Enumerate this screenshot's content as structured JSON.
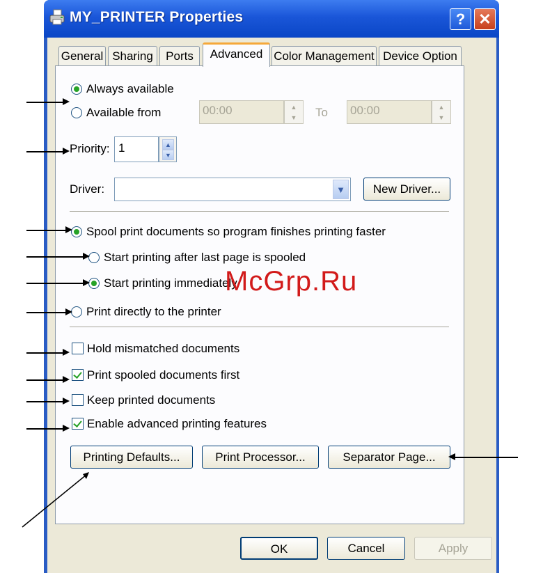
{
  "window": {
    "title": "MY_PRINTER Properties",
    "help_label": "?",
    "close_label": "✕"
  },
  "tabs": [
    "General",
    "Sharing",
    "Ports",
    "Advanced",
    "Color Management",
    "Device Option"
  ],
  "availability": {
    "always_label": "Always available",
    "from_label": "Available from",
    "from_time": "00:00",
    "to_label": "To",
    "to_time": "00:00",
    "selected": "always"
  },
  "priority": {
    "label": "Priority:",
    "value": "1"
  },
  "driver": {
    "label": "Driver:",
    "value": "",
    "new_driver_label": "New Driver..."
  },
  "spooling": {
    "spool_label": "Spool print documents so program finishes printing faster",
    "after_last_label": "Start printing after last page is spooled",
    "immediately_label": "Start printing immediately",
    "direct_label": "Print directly to the printer"
  },
  "options": {
    "hold_label": "Hold mismatched documents",
    "hold_checked": false,
    "spooled_first_label": "Print spooled documents first",
    "spooled_first_checked": true,
    "keep_label": "Keep printed documents",
    "keep_checked": false,
    "advanced_label": "Enable advanced printing features",
    "advanced_checked": true
  },
  "buttons": {
    "printing_defaults": "Printing Defaults...",
    "print_processor": "Print Processor...",
    "separator_page": "Separator Page...",
    "ok": "OK",
    "cancel": "Cancel",
    "apply": "Apply"
  },
  "watermark": "McGrp.Ru",
  "colors": {
    "title_bar": "#0a46c6",
    "dialog_bg": "#ece9d8",
    "active_tab": "#f5a83a",
    "watermark": "#d21a1a"
  }
}
